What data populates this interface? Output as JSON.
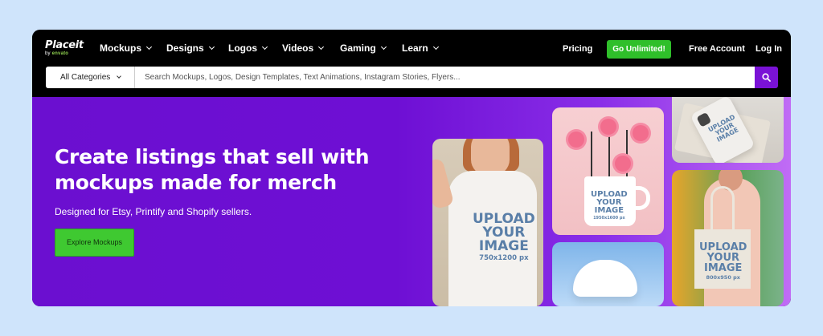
{
  "logo": {
    "brand": "Placeit",
    "sub_prefix": "by",
    "sub_brand": "envato"
  },
  "nav": {
    "items": [
      {
        "label": "Mockups"
      },
      {
        "label": "Designs"
      },
      {
        "label": "Logos"
      },
      {
        "label": "Videos"
      },
      {
        "label": "Gaming"
      },
      {
        "label": "Learn"
      }
    ],
    "pricing": "Pricing",
    "go_unlimited": "Go Unlimited!",
    "free_account": "Free Account",
    "login": "Log In"
  },
  "search": {
    "category": "All Categories",
    "placeholder": "Search Mockups, Logos, Design Templates, Text Animations, Instagram Stories, Flyers..."
  },
  "hero": {
    "title": "Create listings that sell with mockups made for merch",
    "subtitle": "Designed for Etsy, Printify and Shopify sellers.",
    "cta": "Explore Mockups"
  },
  "tiles": {
    "tshirt": {
      "line1": "UPLOAD",
      "line2": "YOUR",
      "line3": "IMAGE",
      "dim": "750x1200 px"
    },
    "mug": {
      "line1": "UPLOAD",
      "line2": "YOUR",
      "line3": "IMAGE",
      "dim": "1950x1600 px"
    },
    "phone": {
      "line1": "UPLOAD",
      "line2": "YOUR",
      "line3": "IMAGE"
    },
    "bag": {
      "line1": "UPLOAD",
      "line2": "YOUR",
      "line3": "IMAGE",
      "dim": "800x950 px"
    }
  },
  "colors": {
    "accent_purple": "#6b0fd0",
    "go_green": "#2fbf2a",
    "search_button": "#7a12d6",
    "page_bg": "#cfe4fb"
  },
  "icons": {
    "search_button": "search-icon",
    "dropdown": "chevron-down-icon"
  }
}
